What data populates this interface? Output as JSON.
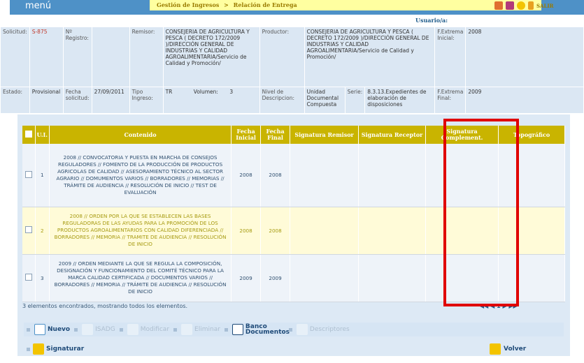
{
  "top": {
    "menu_label": "menú",
    "breadcrumb": [
      "Gestión de Ingresos",
      "Relación de Entrega"
    ],
    "breadcrumb_sep": ">",
    "salir": "SALIR",
    "usuario": "Usuario/a:"
  },
  "info": {
    "solicitud_label": "Solicitud:",
    "solicitud": "S-875",
    "registro_label": "Nº Registro:",
    "remisor_label": "Remisor:",
    "remisor": "CONSEJERIA DE AGRICULTURA Y PESCA ( DECRETO 172/2009 )/DIRECCIÓN GENERAL DE INDUSTRIAS Y CALIDAD AGROALIMENTARIA/Servicio de Calidad y Promoción/",
    "productor_label": "Productor:",
    "productor": "CONSEJERIA DE AGRICULTURA Y PESCA ( DECRETO 172/2009 )/DIRECCIÓN GENERAL DE INDUSTRIAS Y CALIDAD AGROALIMENTARIA/Servicio de Calidad y Promoción/",
    "fext_ini_label": "F.Extrema Inicial:",
    "fext_ini": "2008",
    "estado_label": "Estado:",
    "estado": "Provisional",
    "fecha_sol_label": "Fecha solicitud:",
    "fecha_sol": "27/09/2011",
    "tipo_label": "Tipo Ingreso:",
    "tipo": "TR",
    "volumen_label": "Volumen:",
    "volumen": "3",
    "nivel_label": "Nivel de Descripcion:",
    "nivel": "Unidad Documental Compuesta",
    "serie_label": "Serie:",
    "serie": "8.3.13.Expedientes de elaboración de disposiciones",
    "fext_fin_label": "F.Extrema Final:",
    "fext_fin": "2009"
  },
  "grid": {
    "headers": [
      "U.I.",
      "Contenido",
      "Fecha Inicial",
      "Fecha Final",
      "Signatura Remisor",
      "Signatura Receptor",
      "Signatura Complement.",
      "Topográfico"
    ],
    "rows": [
      {
        "ui": "1",
        "contenido": "2008 // CONVOCATORIA Y PUESTA EN MARCHA DE CONSEJOS REGULADORES // FOMENTO DE LA PRODUCCIÓN DE PRODUCTOS AGRICOLAS DE CALIDAD // ASESORAMIENTO TÉCNICO AL SECTOR AGRARIO // DOMUMENTOS VARIOS // BORRADORES // MEMORIAS // TRÁMITE DE AUDIENCIA // RESOLUCIÓN DE INICIO // TEST DE EVALUACIÓN",
        "fi": "2008",
        "ff": "2008"
      },
      {
        "ui": "2",
        "contenido": "2008 // ORDEN POR LA QUE SE ESTABLECEN LAS BASES REGULADORAS DE LAS AYUDAS PARA LA PROMOCIÓN DE LOS PRODUCTOS AGROALIMENTARIOS CON CALIDAD DIFERENCIADA // BORRADORES // MEMORIA // TRAMITE DE AUDIENCIA // RESOLUCIÓN DE INICIO",
        "fi": "2008",
        "ff": "2008"
      },
      {
        "ui": "3",
        "contenido": "2009 // ORDEN MEDIANTE LA QUE SE REGULA LA COMPOSICIÓN, DESIGNACIÓN Y FUNCIONAMIENTO DEL COMITÉ TÉCNICO PARA LA MARCA CALIDAD CERTIFICADA // DOCUMENTOS VARIOS // BORRADORES // MEMORIA // TRÁMITE DE AUDIENCIA // RESOLUCIÓN DE INICIO",
        "fi": "2009",
        "ff": "2009"
      }
    ],
    "status": "3 elementos encontrados, mostrando todos los elementos.",
    "pager": "1"
  },
  "toolbar": {
    "nuevo": "Nuevo",
    "isadg": "ISADG",
    "modificar": "Modificar",
    "eliminar": "Eliminar",
    "banco": "Banco Documentos",
    "descriptores": "Descriptores",
    "signaturar": "Signaturar",
    "volver": "Volver"
  }
}
